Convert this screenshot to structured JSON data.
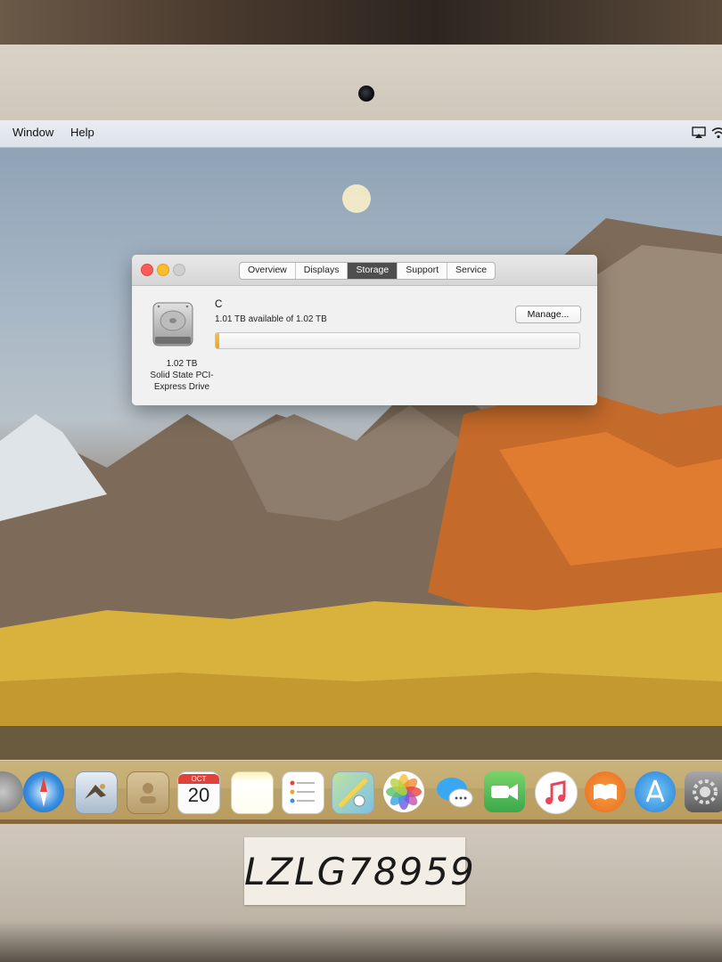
{
  "menubar": {
    "items": [
      "Window",
      "Help"
    ],
    "right_icons": [
      "airplay-icon",
      "wifi-icon"
    ]
  },
  "window": {
    "tabs": [
      {
        "label": "Overview",
        "active": false
      },
      {
        "label": "Displays",
        "active": false
      },
      {
        "label": "Storage",
        "active": true
      },
      {
        "label": "Support",
        "active": false
      },
      {
        "label": "Service",
        "active": false
      }
    ],
    "disk": {
      "icon": "hard-drive-icon",
      "size": "1.02 TB",
      "type_line1": "Solid State PCI-",
      "type_line2": "Express Drive",
      "volume_name": "C",
      "available_text": "1.01 TB available of 1.02 TB",
      "used_fraction": 0.01,
      "manage_label": "Manage..."
    }
  },
  "dock": {
    "calendar_month": "OCT",
    "calendar_day": "20",
    "icons": [
      "launchpad-icon",
      "safari-icon",
      "mail-icon",
      "contacts-icon",
      "calendar-icon",
      "notes-icon",
      "reminders-icon",
      "maps-icon",
      "photos-icon",
      "messages-icon",
      "facetime-icon",
      "itunes-icon",
      "ibooks-icon",
      "app-store-icon",
      "system-preferences-icon"
    ]
  },
  "sticker": {
    "text": "LZLG78959"
  },
  "colors": {
    "bar_fill": "#e4a52f",
    "active_tab": "#4e4e4e",
    "close": "#fc5b57",
    "minimize": "#fdbc2e"
  }
}
